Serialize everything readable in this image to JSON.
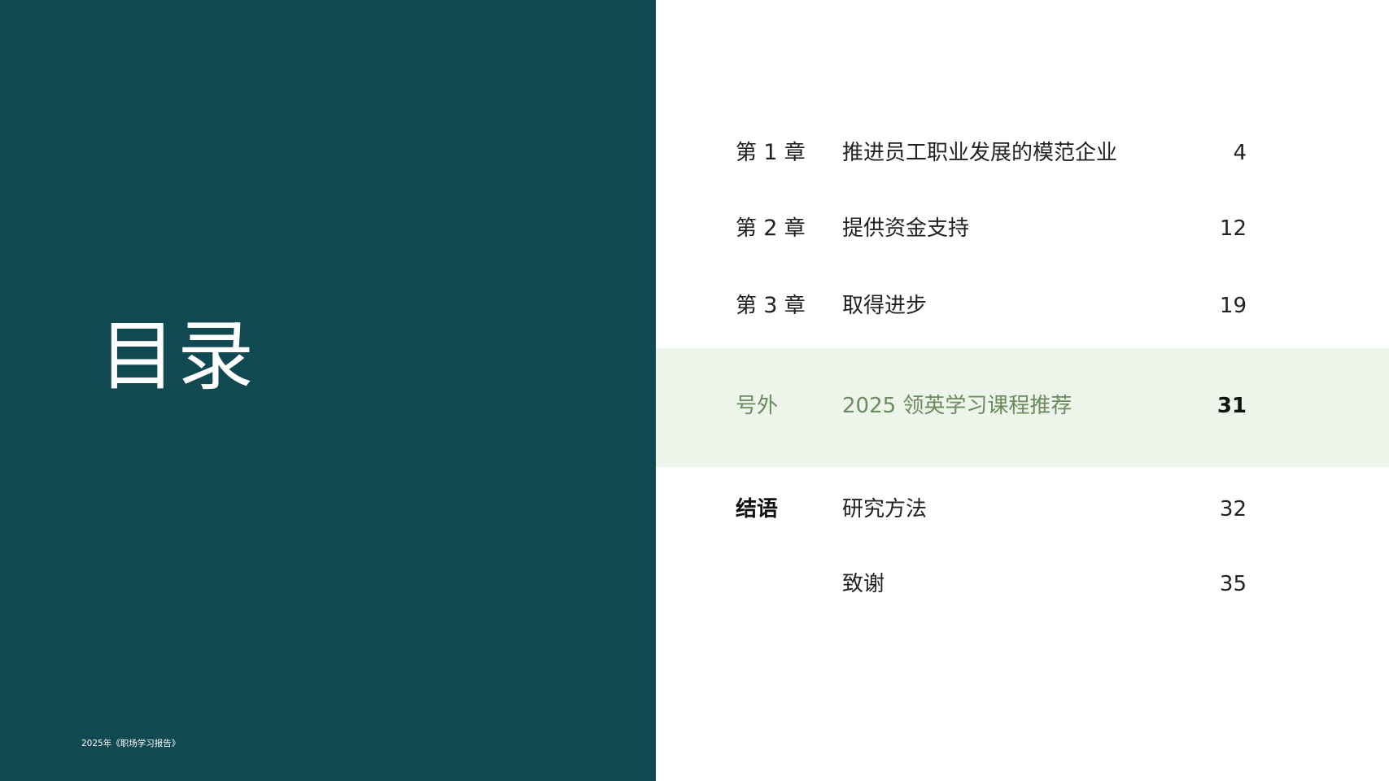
{
  "title": "目录",
  "footer": "2025年《职场学习报告》",
  "colors": {
    "panel": "#114952",
    "highlight_band": "#edf4ea",
    "highlight_text": "#6a8c5e"
  },
  "toc": [
    {
      "prefix": "第",
      "number": "1",
      "suffix": "章",
      "title": "推进员工职业发展的模范企业",
      "page": "4"
    },
    {
      "prefix": "第",
      "number": "2",
      "suffix": "章",
      "title": "提供资金支持",
      "page": "12"
    },
    {
      "prefix": "第",
      "number": "3",
      "suffix": "章",
      "title": "取得进步",
      "page": "19"
    },
    {
      "label": "号外",
      "title": "2025 领英学习课程推荐",
      "page": "31"
    },
    {
      "label": "结语",
      "title": "研究方法",
      "page": "32"
    },
    {
      "label": "",
      "title": "致谢",
      "page": "35"
    }
  ]
}
